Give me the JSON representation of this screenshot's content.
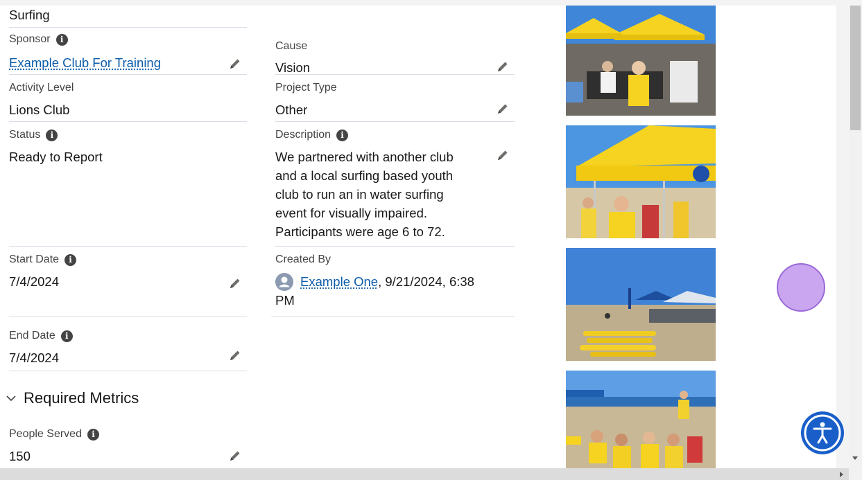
{
  "record": {
    "title_partial": "Surfing",
    "sponsor": {
      "label": "Sponsor",
      "value": "Example Club For Training"
    },
    "cause": {
      "label": "Cause",
      "value": "Vision"
    },
    "activity_level": {
      "label": "Activity Level",
      "value": "Lions Club"
    },
    "project_type": {
      "label": "Project Type",
      "value": "Other"
    },
    "status": {
      "label": "Status",
      "value": "Ready to Report"
    },
    "description": {
      "label": "Description",
      "lines": [
        "We partnered with another club",
        "and a local surfing based youth",
        "club to run an in water surfing",
        "event for visually impaired.",
        "Participants were age 6 to 72."
      ]
    },
    "start_date": {
      "label": "Start Date",
      "value": "7/4/2024"
    },
    "created_by": {
      "label": "Created By",
      "user": "Example One",
      "when_1": ", 9/21/2024, 6:38",
      "when_2": "PM"
    },
    "end_date": {
      "label": "End Date",
      "value": "7/4/2024"
    }
  },
  "metrics": {
    "section_title": "Required Metrics",
    "people_served": {
      "label": "People Served",
      "value": "150"
    }
  },
  "icons": {
    "info": "info-icon",
    "edit": "pencil-icon",
    "collapse": "chevron-down-icon",
    "user": "user-avatar-icon",
    "accessibility": "accessibility-icon"
  },
  "colors": {
    "link": "#0b5cab",
    "accessibility_button": "#1a5fc9",
    "cursor_marker": "#c9a6ef",
    "canopy_yellow": "#f6d320",
    "sky_blue": "#3f86d8"
  }
}
